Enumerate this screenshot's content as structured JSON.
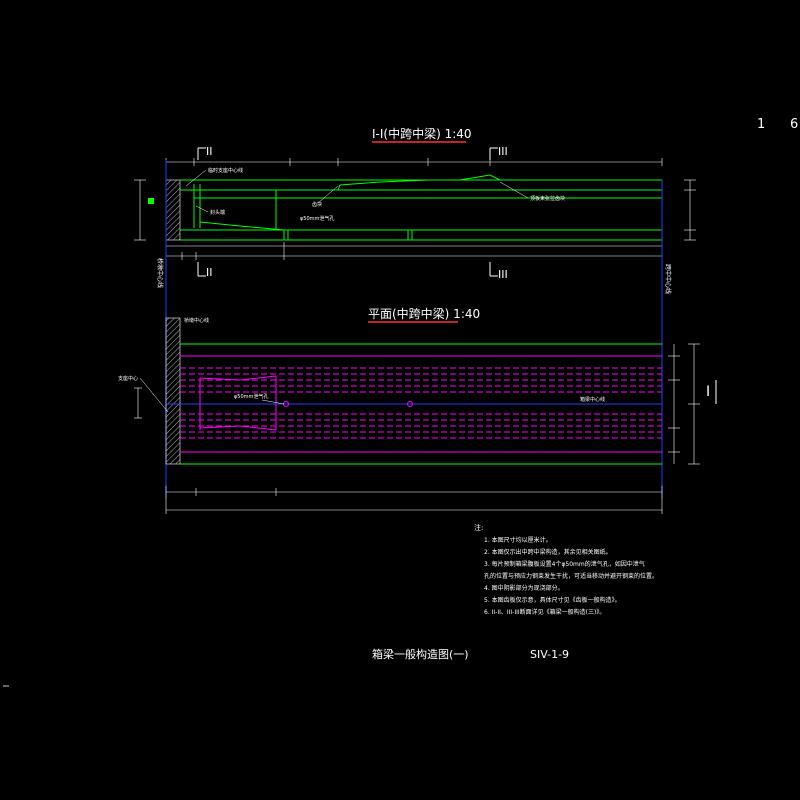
{
  "page": {
    "sheet_no_left": "1",
    "sheet_no_right": "6"
  },
  "colors": {
    "background": "#000000",
    "structure": "#00ff00",
    "plan_lines": "#ff00ff",
    "dimension": "#ffffff",
    "axis": "#0000ff",
    "title_underline": "#ff0000",
    "notes_text": "#ffffff"
  },
  "section_view": {
    "title": "I-I(中跨中梁) 1:40",
    "cut_II_label": "II",
    "cut_III_label": "III",
    "callout_support_centerline": "临时支座中心线",
    "callout_top": "齿块",
    "callout_bottom": "φ50mm泄气孔",
    "callout_left": "封头端",
    "callout_right": "顶板束张拉齿块",
    "left_vertical_label": "桥墩中心线",
    "right_vertical_label": "跨中中心线"
  },
  "plan_view": {
    "title": "平面(中跨中梁) 1:40",
    "callout_top": "桥墩中心线",
    "callout_support": "支座中心",
    "callout_vent": "φ50mm泄气孔",
    "callout_axis": "箱梁中心线",
    "section_mark": "I"
  },
  "notes": {
    "heading": "注:",
    "items": [
      "1. 本图尺寸均以厘米计。",
      "2. 本图仅示出中跨中梁构造，其余见相关图纸。",
      "3. 每片预制箱梁腹板设置4个φ50mm的泄气孔，如因中泄气",
      "   孔的位置与预应力钢束发生干扰，可适当移动并避开钢束的位置。",
      "4. 图中阴影部分为现浇部分。",
      "5. 本图齿板仅示意，具体尺寸见《齿板一般构造》。",
      "6. II-II、III-III断面详见《箱梁一般构造(三)》。"
    ]
  },
  "title_block": {
    "drawing_title": "箱梁一般构造图(一)",
    "drawing_number": "SIV-1-9"
  }
}
